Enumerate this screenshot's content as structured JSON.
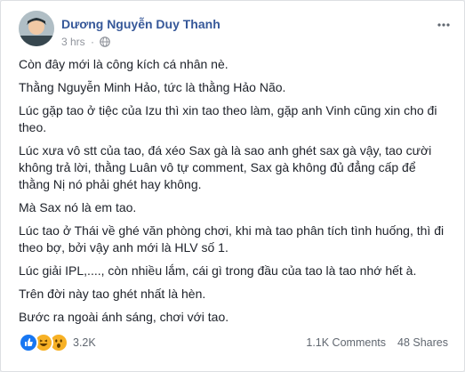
{
  "post": {
    "author": "Dương Nguyễn Duy Thanh",
    "timestamp": "3 hrs",
    "separator": "·",
    "paragraphs": [
      "Còn đây mới là công kích cá nhân nè.",
      "Thằng Nguyễn Minh Hảo, tức là thằng Hảo Não.",
      "Lúc gặp tao ở tiệc của Izu thì xin tao theo làm, gặp anh Vinh cũng xin cho đi theo.",
      "Lúc xưa vô stt của tao, đá xéo Sax gà là sao anh ghét sax gà vậy, tao cười không trả lời, thằng Luân vô tự comment, Sax gà không đủ đẳng cấp để thằng Nị nó phải ghét hay không.",
      "Mà Sax nó là em tao.",
      "Lúc tao ở Thái về ghé văn phòng chơi, khi mà tao phân tích tình huống, thì đi theo bợ, bởi vậy anh mới là HLV số 1.",
      "Lúc giải IPL,...., còn nhiều lắm, cái gì trong đầu của tao là tao nhớ hết à.",
      "Trên đời này tao ghét nhất là hèn.",
      "Bước ra ngoài ánh sáng, chơi với tao."
    ]
  },
  "footer": {
    "reactions": [
      "like-icon",
      "haha-icon",
      "wow-icon"
    ],
    "reaction_count": "3.2K",
    "comments": "1.1K Comments",
    "shares": "48 Shares"
  },
  "colors": {
    "name": "#365899",
    "meta": "#90949c",
    "like": "#1877f2",
    "emoji": "#f7b125"
  }
}
